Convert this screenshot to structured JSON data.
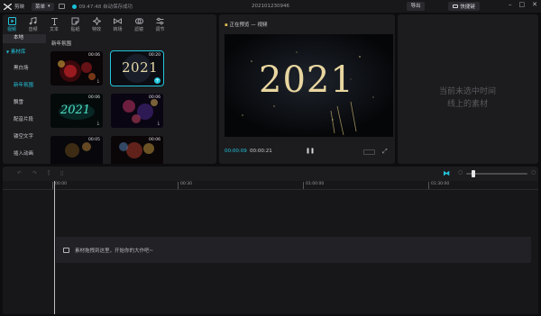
{
  "app": {
    "name": "剪映",
    "menu_label": "菜单",
    "save_status": "09:47:48 自动保存成功",
    "project_title": "202101230946",
    "export_label": "导出",
    "shortcut_label": "快捷键"
  },
  "toolbar": {
    "items": [
      {
        "label": "视频",
        "icon": "video-icon"
      },
      {
        "label": "音频",
        "icon": "audio-icon"
      },
      {
        "label": "文本",
        "icon": "text-icon"
      },
      {
        "label": "贴纸",
        "icon": "sticker-icon"
      },
      {
        "label": "特效",
        "icon": "effects-icon"
      },
      {
        "label": "转场",
        "icon": "transition-icon"
      },
      {
        "label": "滤镜",
        "icon": "filter-icon"
      },
      {
        "label": "调节",
        "icon": "adjust-icon"
      }
    ]
  },
  "sidebar": {
    "items": [
      {
        "label": "本地"
      },
      {
        "label": "素材库"
      },
      {
        "label": "黑白场"
      },
      {
        "label": "新年氛围"
      },
      {
        "label": "飘雪"
      },
      {
        "label": "配音片段"
      },
      {
        "label": "镂空文字"
      },
      {
        "label": "插入动画"
      }
    ]
  },
  "library": {
    "section_title": "新年氛围",
    "thumbs": [
      {
        "duration": "00:06"
      },
      {
        "duration": "00:20"
      },
      {
        "duration": "00:06"
      },
      {
        "duration": "00:06"
      },
      {
        "duration": "00:05"
      },
      {
        "duration": "00:06"
      }
    ],
    "thumb2_text": "2021",
    "thumb3_text": "2021"
  },
  "player": {
    "title": "正在预览 — 视频",
    "video_text": "2021",
    "current_time": "00:00:09",
    "total_time": "00:00:21"
  },
  "attributes": {
    "empty_line1": "当前未选中时间",
    "empty_line2": "线上的素材"
  },
  "timeline": {
    "ruler_ticks": [
      "00:00",
      "00:30",
      "01:00:00",
      "01:30:00"
    ],
    "track_hint": "素材拖拽到这里，开始你的大作吧~"
  },
  "colors": {
    "accent": "#23c5dc",
    "background": "#0d0d0f",
    "panel": "#1c1c1f"
  }
}
